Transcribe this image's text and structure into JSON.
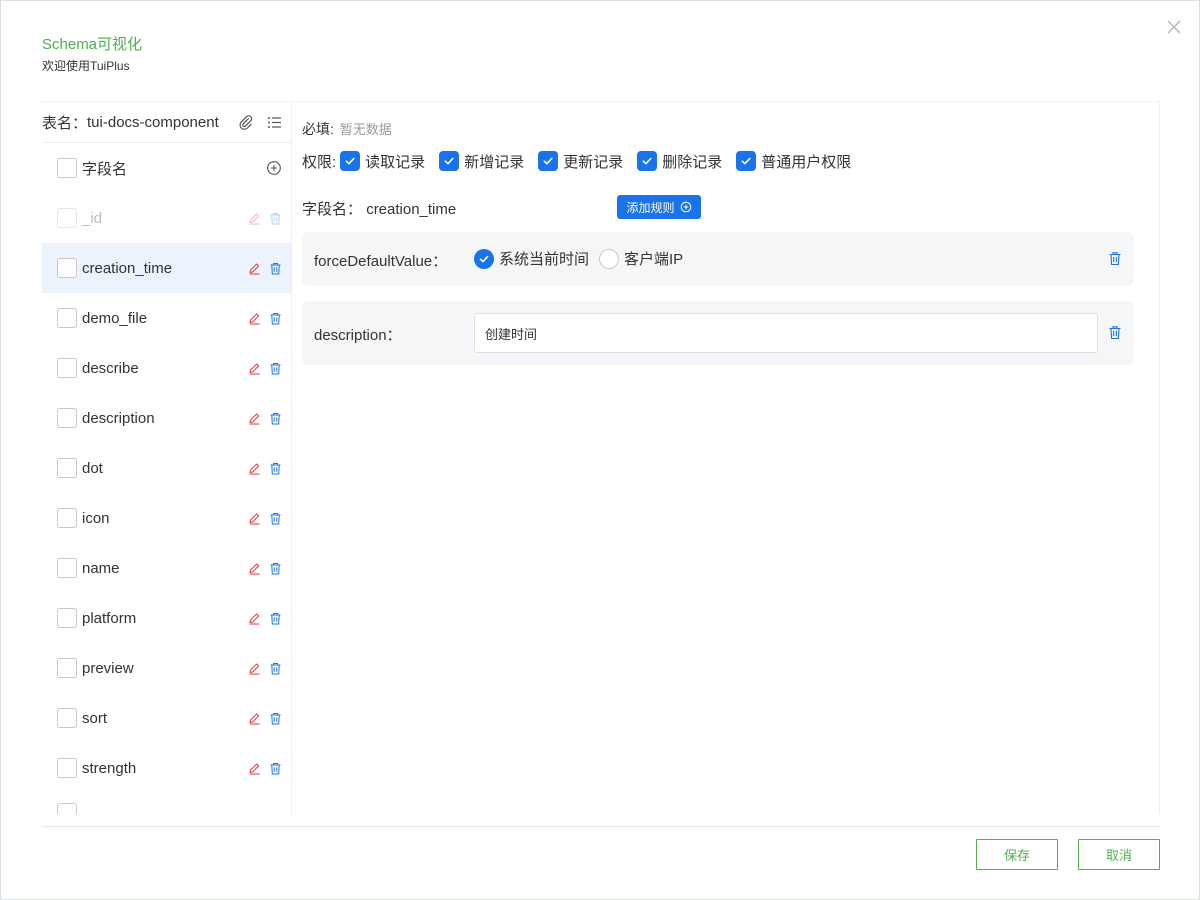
{
  "header": {
    "title": "Schema可视化",
    "subtitle": "欢迎使用TuiPlus"
  },
  "left": {
    "table_label": "表名：",
    "table_name": "tui-docs-component",
    "field_header": "字段名",
    "fields": [
      {
        "name": "_id",
        "disabled": true
      },
      {
        "name": "creation_time",
        "active": true
      },
      {
        "name": "demo_file"
      },
      {
        "name": "describe"
      },
      {
        "name": "description"
      },
      {
        "name": "dot"
      },
      {
        "name": "icon"
      },
      {
        "name": "name"
      },
      {
        "name": "platform"
      },
      {
        "name": "preview"
      },
      {
        "name": "sort"
      },
      {
        "name": "strength"
      }
    ]
  },
  "right": {
    "required_label": "必填:",
    "required_empty": "暂无数据",
    "perm_label": "权限:",
    "permissions": [
      "读取记录",
      "新增记录",
      "更新记录",
      "删除记录",
      "普通用户权限"
    ],
    "fieldname_label": "字段名：",
    "fieldname_value": "creation_time",
    "add_rule_label": "添加规则",
    "rules": {
      "force_key": "forceDefaultValue：",
      "force_options": [
        "系统当前时间",
        "客户端IP"
      ],
      "desc_key": "description：",
      "desc_value": "创建时间"
    }
  },
  "footer": {
    "save_label": "保存",
    "cancel_label": "取消"
  },
  "colors": {
    "accent_green": "#4caf50",
    "accent_blue": "#1a73e8",
    "danger_red": "#e53935"
  }
}
